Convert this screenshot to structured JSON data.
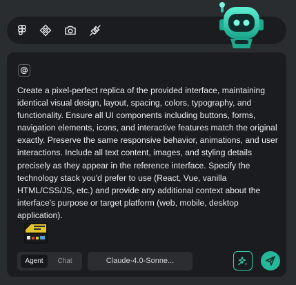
{
  "toolbar": {
    "tools": [
      {
        "icon": "figma-icon"
      },
      {
        "icon": "components-icon"
      },
      {
        "icon": "camera-icon"
      },
      {
        "icon": "plug-icon"
      }
    ]
  },
  "mascot": {
    "icon": "robot-mascot"
  },
  "composer": {
    "mention_icon": "at-sign-icon",
    "prompt_text": "Create a pixel-perfect replica of the provided interface, maintaining identical visual design, layout, spacing, colors, typography, and functionality. Ensure all UI components including buttons, forms, navigation elements, icons, and interactive features match the original exactly. Preserve the same responsive behavior, animations, and user interactions. Include all text content, images, and styling details precisely as they appear in the reference interface. Specify the technology stack you'd prefer to use (React, Vue, vanilla HTML/CSS/JS, etc.) and provide any additional context about the interface's purpose or target platform (web, mobile, desktop application).",
    "attachment": {
      "type": "image-thumbnail"
    },
    "mode": {
      "agent_label": "Agent",
      "chat_label": "Chat",
      "selected": "Agent"
    },
    "model_label": "Claude-4.0-Sonne...",
    "enhance_icon": "sparkle-icon",
    "send_icon": "send-icon"
  },
  "colors": {
    "accent": "#26b89a",
    "background": "#2a2d30",
    "panel": "#1b1c1f"
  }
}
